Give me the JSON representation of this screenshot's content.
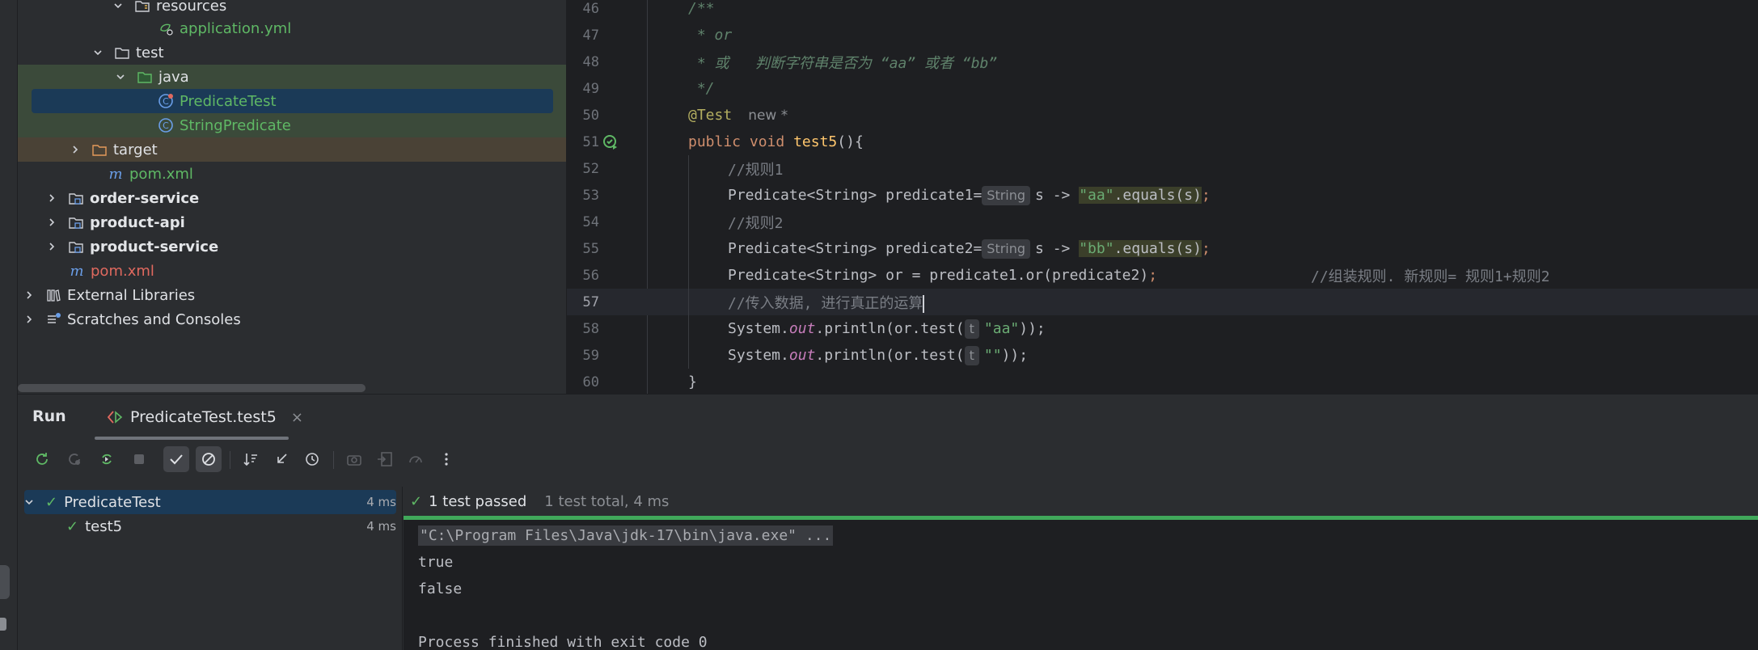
{
  "project_tree": {
    "items": [
      {
        "label": "resources",
        "kind": "folder-resources",
        "arrow": "down"
      },
      {
        "label": "application.yml",
        "kind": "yml-file"
      },
      {
        "label": "test",
        "kind": "folder",
        "arrow": "down"
      },
      {
        "label": "java",
        "kind": "folder-test-sources",
        "arrow": "down"
      },
      {
        "label": "PredicateTest",
        "kind": "test-class"
      },
      {
        "label": "StringPredicate",
        "kind": "class"
      },
      {
        "label": "target",
        "kind": "folder-excluded",
        "arrow": "right"
      },
      {
        "label": "pom.xml",
        "kind": "maven-file"
      },
      {
        "label": "order-service",
        "kind": "module",
        "arrow": "right"
      },
      {
        "label": "product-api",
        "kind": "module",
        "arrow": "right"
      },
      {
        "label": "product-service",
        "kind": "module",
        "arrow": "right"
      },
      {
        "label": "pom.xml",
        "kind": "maven-file"
      },
      {
        "label": "External Libraries",
        "kind": "libraries",
        "arrow": "right"
      },
      {
        "label": "Scratches and Consoles",
        "kind": "scratches",
        "arrow": "right"
      }
    ]
  },
  "editor": {
    "lines": [
      {
        "n": "46"
      },
      {
        "n": "47"
      },
      {
        "n": "48"
      },
      {
        "n": "49"
      },
      {
        "n": "50"
      },
      {
        "n": "51"
      },
      {
        "n": "52"
      },
      {
        "n": "53"
      },
      {
        "n": "54"
      },
      {
        "n": "55"
      },
      {
        "n": "56"
      },
      {
        "n": "57"
      },
      {
        "n": "58"
      },
      {
        "n": "59"
      },
      {
        "n": "60"
      }
    ],
    "doc_open": "/**",
    "doc_or": " * or",
    "doc_desc": " * 或   判断字符串是否为 “aa” 或者 “bb”",
    "doc_close": " */",
    "annotation": "@Test",
    "usage_hint": "new *",
    "kw_public": "public",
    "kw_void": "void",
    "method_name": "test5",
    "method_paren": "(){",
    "comment_rule1": "//规则1",
    "type_predicate": "Predicate<String>",
    "var_p1": " predicate1=",
    "hint_string": "String",
    "lambda_s": "s -> ",
    "str_aa": "\"aa\"",
    "str_bb": "\"bb\"",
    "equals_s": ".equals(s)",
    "semicolon": ";",
    "comment_rule2": "//规则2",
    "var_p2": " predicate2=",
    "or_assign": " or = predicate1.or(predicate2)",
    "comment_combine": "//组装规则. 新规则= 规则1+规则2",
    "comment_pass": "//传入数据, 进行真正的运算",
    "system": "System.",
    "out": "out",
    "println_or_test": ".println(or.test(",
    "hint_t": "t",
    "str_empty": "\"\"",
    "close_call": "));",
    "close_brace": "}"
  },
  "run_panel": {
    "title": "Run",
    "tab_label": "PredicateTest.test5",
    "tab_close": "×",
    "tree": [
      {
        "label": "PredicateTest",
        "time": "4 ms"
      },
      {
        "label": "test5",
        "time": "4 ms"
      }
    ],
    "status_passed": "1 test passed",
    "status_total": "1 test total, 4 ms",
    "progress": 1.0,
    "console": {
      "cmd": "\"C:\\Program Files\\Java\\jdk-17\\bin\\java.exe\" ...",
      "line1": "true",
      "line2": "false",
      "line3": "Process finished with exit code 0"
    }
  },
  "colors": {
    "pass_green": "#5fb865",
    "keyword": "#cf8e6d",
    "string": "#6aab73",
    "method": "#ffc66d"
  }
}
